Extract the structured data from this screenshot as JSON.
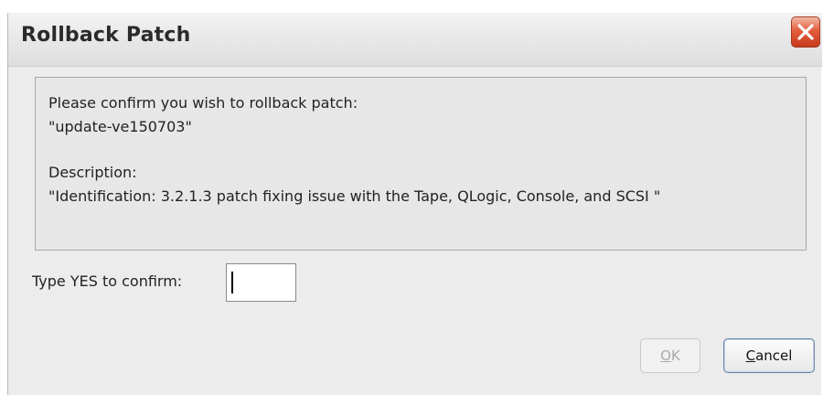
{
  "dialog": {
    "title": "Rollback Patch",
    "close_icon": "close-icon",
    "message": {
      "line1": "Please confirm you wish to rollback patch:",
      "patch_name": "\"update-ve150703\"",
      "description_label": "Description:",
      "description": "\"Identification: 3.2.1.3 patch fixing issue with the Tape, QLogic, Console, and SCSI \""
    },
    "confirm": {
      "label": "Type YES to confirm:",
      "value": ""
    },
    "buttons": {
      "ok": {
        "mnemonic": "O",
        "rest": "K",
        "enabled": false
      },
      "cancel": {
        "mnemonic": "C",
        "rest": "ancel",
        "enabled": true
      }
    }
  },
  "colors": {
    "window_bg": "#ececec",
    "close_button": "#e35d3c",
    "disabled_text": "#a9a9a9"
  }
}
